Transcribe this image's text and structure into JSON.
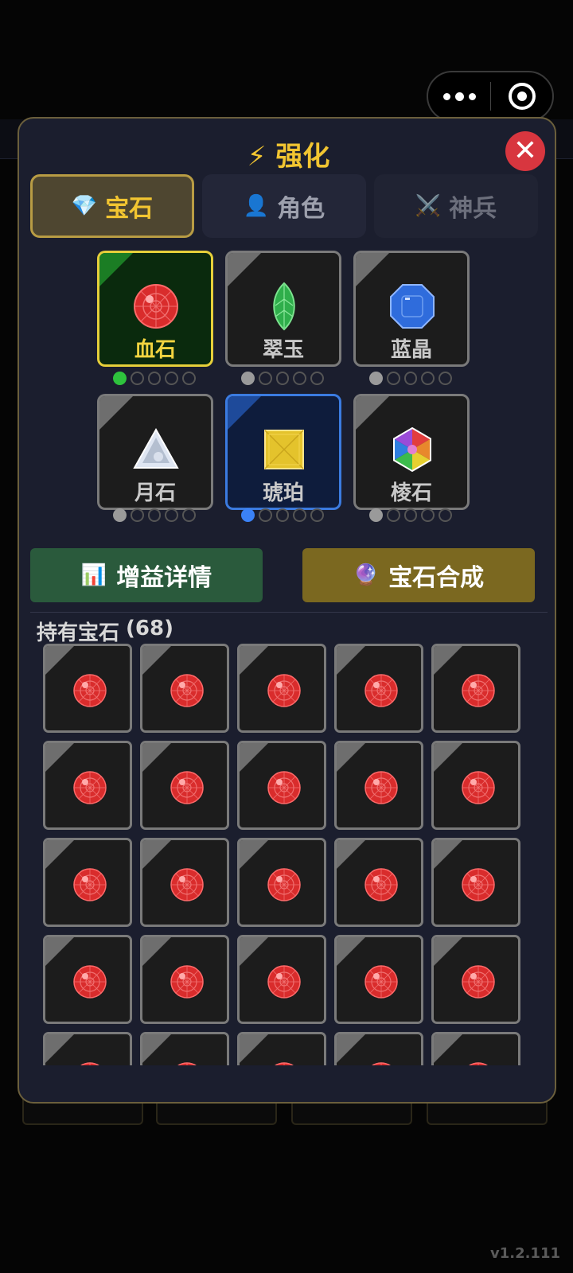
{
  "panel": {
    "title_icon": "⚡",
    "title": "强化",
    "close_icon": "close-icon"
  },
  "tabs": [
    {
      "icon": "💎",
      "label": "宝石",
      "active": true
    },
    {
      "icon": "👤",
      "label": "角色",
      "active": false
    },
    {
      "icon": "⚔️",
      "label": "神兵",
      "active": false
    }
  ],
  "gems": [
    {
      "name": "血石",
      "icon": "red-orb-gem-icon",
      "level": 1,
      "max_level": 5,
      "selected": true
    },
    {
      "name": "翠玉",
      "icon": "green-leaf-gem-icon",
      "level": 1,
      "max_level": 5
    },
    {
      "name": "蓝晶",
      "icon": "blue-octagon-gem-icon",
      "level": 1,
      "max_level": 5
    },
    {
      "name": "月石",
      "icon": "white-triangle-gem-icon",
      "level": 1,
      "max_level": 5
    },
    {
      "name": "琥珀",
      "icon": "yellow-square-gem-icon",
      "level": 1,
      "max_level": 5
    },
    {
      "name": "棱石",
      "icon": "rainbow-hexagon-gem-icon",
      "level": 1,
      "max_level": 5
    }
  ],
  "buttons": {
    "detail_icon": "📊",
    "detail_label": "增益详情",
    "synth_icon": "🔮",
    "synth_label": "宝石合成"
  },
  "owned": {
    "label": "持有宝石",
    "count": "(68)",
    "visible_item_icon": "red-orb-gem-icon"
  },
  "version": "v1.2.111",
  "colors": {
    "accent_gold": "#f2c531",
    "panel_bg": "#1b1e2e",
    "close_red": "#d8363f",
    "detail_green": "#2a5a3c",
    "synth_gold": "#7b6820"
  }
}
